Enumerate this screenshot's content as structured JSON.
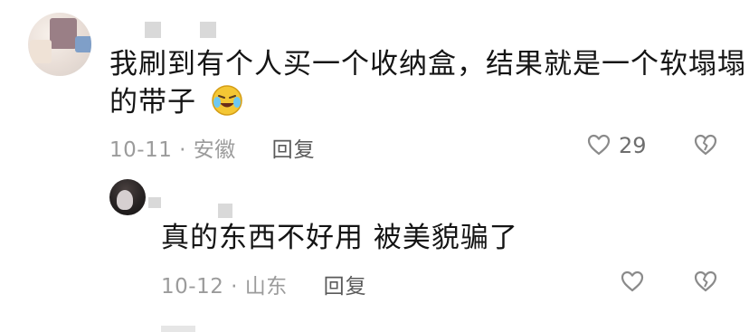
{
  "comments": [
    {
      "text_line1": "我刷到有个人买一个收纳盒，结果就是一个软塌塌",
      "text_line2": "的带子",
      "emoji": "crying-laughing-face",
      "date": "10-11",
      "location": "· 安徽",
      "reply_label": "回复",
      "like_count": "29",
      "avatar": "user-avatar-blurred",
      "username": "blurred-username"
    }
  ],
  "replies": [
    {
      "text": "真的东西不好用 被美貌骗了",
      "date": "10-12",
      "location": "· 山东",
      "reply_label": "回复",
      "like_count": "",
      "avatar": "user-avatar-dark",
      "username": "blurred-username"
    }
  ],
  "icons": {
    "like": "heart-outline-icon",
    "dislike": "broken-heart-outline-icon"
  },
  "colors": {
    "text": "#141414",
    "meta": "#9b9b9b",
    "reply": "#5a5a5a",
    "icon": "#8a8a8a"
  }
}
